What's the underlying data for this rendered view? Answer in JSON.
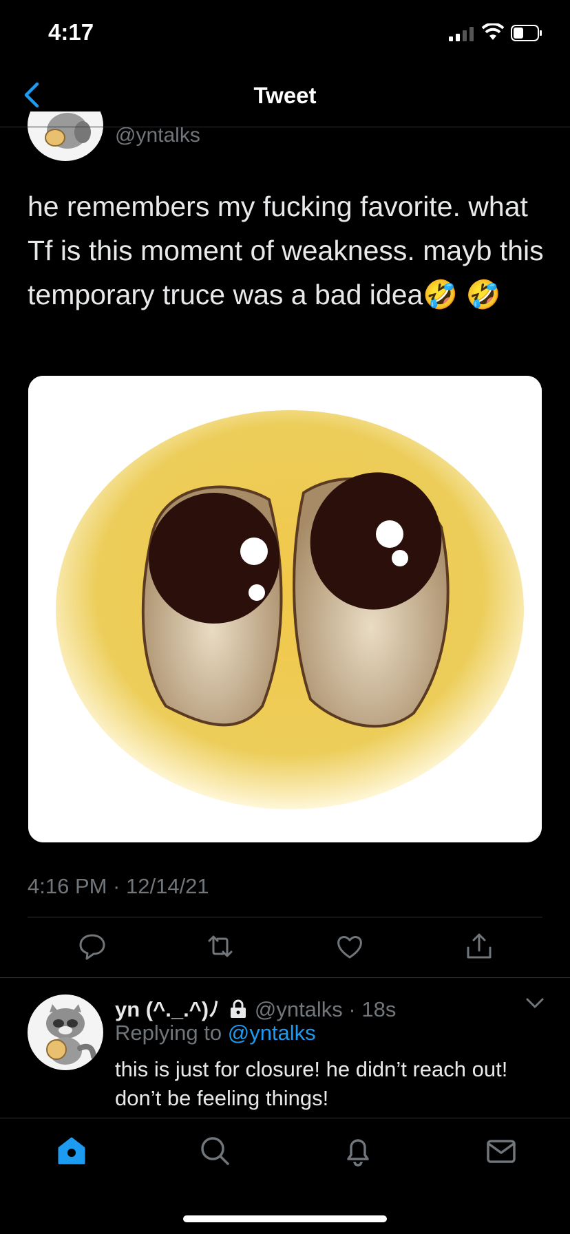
{
  "status": {
    "time": "4:17"
  },
  "nav": {
    "title": "Tweet"
  },
  "tweet": {
    "handle": "@yntalks",
    "text": "he remembers my fucking favorite. what Tf is this moment of weakness. mayb this temporary truce was a bad idea🤣 🤣",
    "timestamp": "4:16 PM · 12/14/21"
  },
  "reply": {
    "name": "yn (^._.^)ﾉ",
    "handle_time": "@yntalks · 18s",
    "replying_prefix": "Replying to",
    "replying_handle": "@yntalks",
    "text": "this is just for closure! he didn’t reach out! don’t be feeling things!"
  },
  "icons": {
    "actions": [
      "reply-icon",
      "retweet-icon",
      "like-icon",
      "share-icon"
    ],
    "tabs": [
      "home-icon",
      "search-icon",
      "notifications-icon",
      "messages-icon"
    ],
    "accent": "#1d9bf0"
  }
}
